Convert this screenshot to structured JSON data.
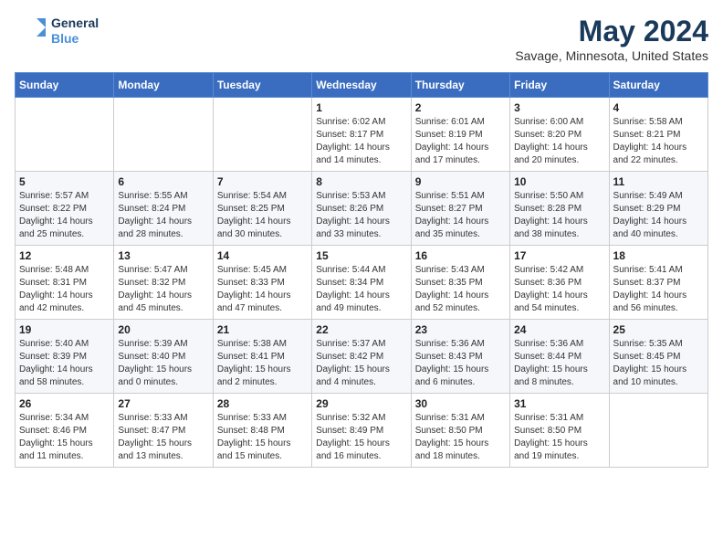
{
  "logo": {
    "line1": "General",
    "line2": "Blue"
  },
  "title": "May 2024",
  "location": "Savage, Minnesota, United States",
  "weekdays": [
    "Sunday",
    "Monday",
    "Tuesday",
    "Wednesday",
    "Thursday",
    "Friday",
    "Saturday"
  ],
  "weeks": [
    [
      {
        "day": "",
        "sunrise": "",
        "sunset": "",
        "daylight": ""
      },
      {
        "day": "",
        "sunrise": "",
        "sunset": "",
        "daylight": ""
      },
      {
        "day": "",
        "sunrise": "",
        "sunset": "",
        "daylight": ""
      },
      {
        "day": "1",
        "sunrise": "Sunrise: 6:02 AM",
        "sunset": "Sunset: 8:17 PM",
        "daylight": "Daylight: 14 hours and 14 minutes."
      },
      {
        "day": "2",
        "sunrise": "Sunrise: 6:01 AM",
        "sunset": "Sunset: 8:19 PM",
        "daylight": "Daylight: 14 hours and 17 minutes."
      },
      {
        "day": "3",
        "sunrise": "Sunrise: 6:00 AM",
        "sunset": "Sunset: 8:20 PM",
        "daylight": "Daylight: 14 hours and 20 minutes."
      },
      {
        "day": "4",
        "sunrise": "Sunrise: 5:58 AM",
        "sunset": "Sunset: 8:21 PM",
        "daylight": "Daylight: 14 hours and 22 minutes."
      }
    ],
    [
      {
        "day": "5",
        "sunrise": "Sunrise: 5:57 AM",
        "sunset": "Sunset: 8:22 PM",
        "daylight": "Daylight: 14 hours and 25 minutes."
      },
      {
        "day": "6",
        "sunrise": "Sunrise: 5:55 AM",
        "sunset": "Sunset: 8:24 PM",
        "daylight": "Daylight: 14 hours and 28 minutes."
      },
      {
        "day": "7",
        "sunrise": "Sunrise: 5:54 AM",
        "sunset": "Sunset: 8:25 PM",
        "daylight": "Daylight: 14 hours and 30 minutes."
      },
      {
        "day": "8",
        "sunrise": "Sunrise: 5:53 AM",
        "sunset": "Sunset: 8:26 PM",
        "daylight": "Daylight: 14 hours and 33 minutes."
      },
      {
        "day": "9",
        "sunrise": "Sunrise: 5:51 AM",
        "sunset": "Sunset: 8:27 PM",
        "daylight": "Daylight: 14 hours and 35 minutes."
      },
      {
        "day": "10",
        "sunrise": "Sunrise: 5:50 AM",
        "sunset": "Sunset: 8:28 PM",
        "daylight": "Daylight: 14 hours and 38 minutes."
      },
      {
        "day": "11",
        "sunrise": "Sunrise: 5:49 AM",
        "sunset": "Sunset: 8:29 PM",
        "daylight": "Daylight: 14 hours and 40 minutes."
      }
    ],
    [
      {
        "day": "12",
        "sunrise": "Sunrise: 5:48 AM",
        "sunset": "Sunset: 8:31 PM",
        "daylight": "Daylight: 14 hours and 42 minutes."
      },
      {
        "day": "13",
        "sunrise": "Sunrise: 5:47 AM",
        "sunset": "Sunset: 8:32 PM",
        "daylight": "Daylight: 14 hours and 45 minutes."
      },
      {
        "day": "14",
        "sunrise": "Sunrise: 5:45 AM",
        "sunset": "Sunset: 8:33 PM",
        "daylight": "Daylight: 14 hours and 47 minutes."
      },
      {
        "day": "15",
        "sunrise": "Sunrise: 5:44 AM",
        "sunset": "Sunset: 8:34 PM",
        "daylight": "Daylight: 14 hours and 49 minutes."
      },
      {
        "day": "16",
        "sunrise": "Sunrise: 5:43 AM",
        "sunset": "Sunset: 8:35 PM",
        "daylight": "Daylight: 14 hours and 52 minutes."
      },
      {
        "day": "17",
        "sunrise": "Sunrise: 5:42 AM",
        "sunset": "Sunset: 8:36 PM",
        "daylight": "Daylight: 14 hours and 54 minutes."
      },
      {
        "day": "18",
        "sunrise": "Sunrise: 5:41 AM",
        "sunset": "Sunset: 8:37 PM",
        "daylight": "Daylight: 14 hours and 56 minutes."
      }
    ],
    [
      {
        "day": "19",
        "sunrise": "Sunrise: 5:40 AM",
        "sunset": "Sunset: 8:39 PM",
        "daylight": "Daylight: 14 hours and 58 minutes."
      },
      {
        "day": "20",
        "sunrise": "Sunrise: 5:39 AM",
        "sunset": "Sunset: 8:40 PM",
        "daylight": "Daylight: 15 hours and 0 minutes."
      },
      {
        "day": "21",
        "sunrise": "Sunrise: 5:38 AM",
        "sunset": "Sunset: 8:41 PM",
        "daylight": "Daylight: 15 hours and 2 minutes."
      },
      {
        "day": "22",
        "sunrise": "Sunrise: 5:37 AM",
        "sunset": "Sunset: 8:42 PM",
        "daylight": "Daylight: 15 hours and 4 minutes."
      },
      {
        "day": "23",
        "sunrise": "Sunrise: 5:36 AM",
        "sunset": "Sunset: 8:43 PM",
        "daylight": "Daylight: 15 hours and 6 minutes."
      },
      {
        "day": "24",
        "sunrise": "Sunrise: 5:36 AM",
        "sunset": "Sunset: 8:44 PM",
        "daylight": "Daylight: 15 hours and 8 minutes."
      },
      {
        "day": "25",
        "sunrise": "Sunrise: 5:35 AM",
        "sunset": "Sunset: 8:45 PM",
        "daylight": "Daylight: 15 hours and 10 minutes."
      }
    ],
    [
      {
        "day": "26",
        "sunrise": "Sunrise: 5:34 AM",
        "sunset": "Sunset: 8:46 PM",
        "daylight": "Daylight: 15 hours and 11 minutes."
      },
      {
        "day": "27",
        "sunrise": "Sunrise: 5:33 AM",
        "sunset": "Sunset: 8:47 PM",
        "daylight": "Daylight: 15 hours and 13 minutes."
      },
      {
        "day": "28",
        "sunrise": "Sunrise: 5:33 AM",
        "sunset": "Sunset: 8:48 PM",
        "daylight": "Daylight: 15 hours and 15 minutes."
      },
      {
        "day": "29",
        "sunrise": "Sunrise: 5:32 AM",
        "sunset": "Sunset: 8:49 PM",
        "daylight": "Daylight: 15 hours and 16 minutes."
      },
      {
        "day": "30",
        "sunrise": "Sunrise: 5:31 AM",
        "sunset": "Sunset: 8:50 PM",
        "daylight": "Daylight: 15 hours and 18 minutes."
      },
      {
        "day": "31",
        "sunrise": "Sunrise: 5:31 AM",
        "sunset": "Sunset: 8:50 PM",
        "daylight": "Daylight: 15 hours and 19 minutes."
      },
      {
        "day": "",
        "sunrise": "",
        "sunset": "",
        "daylight": ""
      }
    ]
  ]
}
